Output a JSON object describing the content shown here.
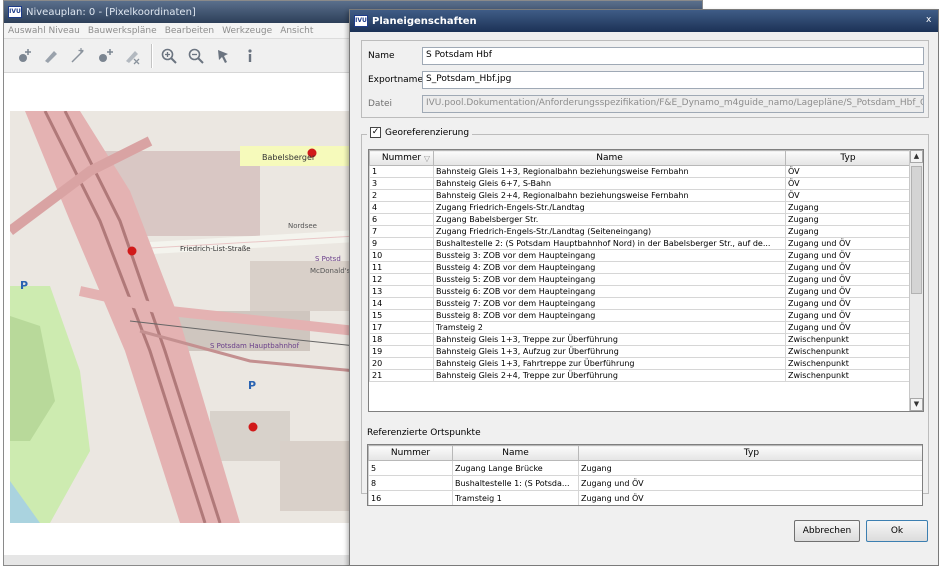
{
  "background_window": {
    "title": "Niveauplan: 0 - [Pixelkoordinaten]",
    "menu": [
      "Auswahl Niveau",
      "Bauwerkspläne",
      "Bearbeiten",
      "Werkzeuge",
      "Ansicht"
    ],
    "toolbar_icons": [
      "add-point-icon",
      "add-area-icon",
      "add-line-icon",
      "add-node-icon",
      "delete-icon",
      "zoom-in-icon",
      "zoom-out-icon",
      "pointer-icon",
      "info-icon"
    ],
    "map_labels": {
      "babelsberger": "Babelsberger",
      "friedrich_list": "Friedrich-List-Straße",
      "nordsee": "Nordsee",
      "mcdonalds": "McDonald's",
      "s_potsdam": "S Potsd",
      "parking": "P",
      "bahnhof": "S Potsdam Hauptbahnhof"
    },
    "colors": {
      "rail": "#d9a3a3",
      "station": "#a67a7a",
      "water": "#aad3df",
      "green": "#cdebb0",
      "building": "#d9d0c9",
      "marker": "#d11a1a"
    }
  },
  "dialog": {
    "title": "Planeigenschaften",
    "close_glyph": "x",
    "fields": {
      "name_label": "Name",
      "name_value": "S Potsdam Hbf",
      "export_label": "Exportname",
      "export_value": "S_Potsdam_Hbf.jpg",
      "file_label": "Datei",
      "file_value": "IVU.pool.Dokumentation/Anforderungsspezifikation/F&E_Dynamo_m4guide_namo/Lagepläne/S_Potsdam_Hbf_OSM.JPG"
    },
    "georef": {
      "label": "Georeferenzierung",
      "checked_glyph": "✓",
      "columns": [
        "Nummer",
        "Name",
        "Typ"
      ],
      "rows": [
        {
          "nr": "1",
          "name": "Bahnsteig Gleis 1+3, Regionalbahn beziehungsweise Fernbahn",
          "typ": "ÖV"
        },
        {
          "nr": "3",
          "name": "Bahnsteig Gleis 6+7, S-Bahn",
          "typ": "ÖV"
        },
        {
          "nr": "2",
          "name": "Bahnsteig Gleis 2+4, Regionalbahn beziehungsweise Fernbahn",
          "typ": "ÖV"
        },
        {
          "nr": "4",
          "name": "Zugang Friedrich-Engels-Str./Landtag",
          "typ": "Zugang"
        },
        {
          "nr": "6",
          "name": "Zugang Babelsberger Str.",
          "typ": "Zugang"
        },
        {
          "nr": "7",
          "name": "Zugang Friedrich-Engels-Str./Landtag (Seiteneingang)",
          "typ": "Zugang"
        },
        {
          "nr": "9",
          "name": "Bushaltestelle 2: (S Potsdam Hauptbahnhof Nord) in der Babelsberger Str., auf de...",
          "typ": "Zugang und ÖV"
        },
        {
          "nr": "10",
          "name": "Bussteig 3: ZOB vor dem Haupteingang",
          "typ": "Zugang und ÖV"
        },
        {
          "nr": "11",
          "name": "Bussteig 4: ZOB vor dem Haupteingang",
          "typ": "Zugang und ÖV"
        },
        {
          "nr": "12",
          "name": "Bussteig 5: ZOB vor dem Haupteingang",
          "typ": "Zugang und ÖV"
        },
        {
          "nr": "13",
          "name": "Bussteig 6: ZOB vor dem Haupteingang",
          "typ": "Zugang und ÖV"
        },
        {
          "nr": "14",
          "name": "Bussteig 7: ZOB vor dem Haupteingang",
          "typ": "Zugang und ÖV"
        },
        {
          "nr": "15",
          "name": "Bussteig 8: ZOB vor dem Haupteingang",
          "typ": "Zugang und ÖV"
        },
        {
          "nr": "17",
          "name": "Tramsteig 2",
          "typ": "Zugang und ÖV"
        },
        {
          "nr": "18",
          "name": "Bahnsteig Gleis 1+3, Treppe zur Überführung",
          "typ": "Zwischenpunkt"
        },
        {
          "nr": "19",
          "name": "Bahnsteig Gleis 1+3, Aufzug zur Überführung",
          "typ": "Zwischenpunkt"
        },
        {
          "nr": "20",
          "name": "Bahnsteig Gleis 1+3, Fahrtreppe zur Überführung",
          "typ": "Zwischenpunkt"
        },
        {
          "nr": "21",
          "name": "Bahnsteig Gleis 2+4, Treppe zur Überführung",
          "typ": "Zwischenpunkt"
        }
      ]
    },
    "ref": {
      "label": "Referenzierte Ortspunkte",
      "columns": [
        "Nummer",
        "Name",
        "Typ"
      ],
      "rows": [
        {
          "nr": "5",
          "name": "Zugang Lange Brücke",
          "typ": "Zugang"
        },
        {
          "nr": "8",
          "name": "Bushaltestelle 1: (S Potsda...",
          "typ": "Zugang und ÖV"
        },
        {
          "nr": "16",
          "name": "Tramsteig 1",
          "typ": "Zugang und ÖV"
        }
      ]
    },
    "buttons": {
      "cancel": "Abbrechen",
      "ok": "Ok"
    }
  }
}
